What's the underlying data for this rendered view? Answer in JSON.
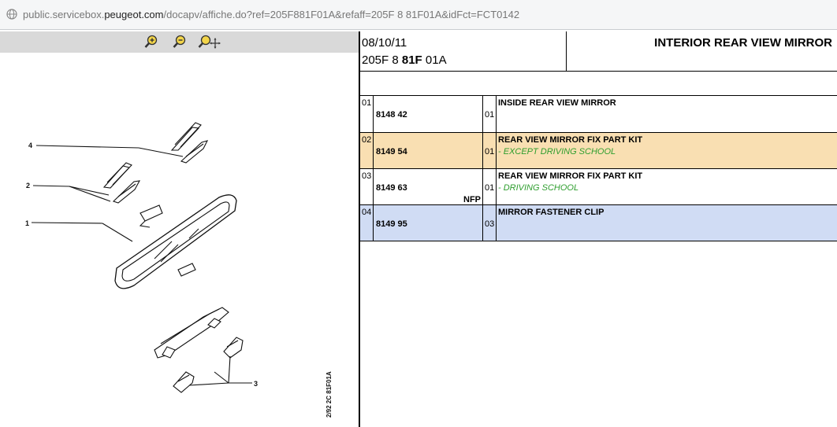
{
  "browser": {
    "url_prefix": "public.servicebox.",
    "url_domain": "peugeot.com",
    "url_suffix": "/docapv/affiche.do?ref=205F881F01A&refaff=205F 8 81F01A&idFct=FCT0142"
  },
  "toolbar": {
    "icons": [
      "zoom-in-icon",
      "zoom-out-icon",
      "zoom-pan-icon"
    ]
  },
  "diagram": {
    "callouts": [
      "4",
      "2",
      "1",
      "3"
    ],
    "stamp": "2/92 2C 81F01A"
  },
  "header": {
    "date": "08/10/11",
    "ref_prefix": "205F 8 ",
    "ref_bold": "81F",
    "ref_suffix": " 01A",
    "title": "INTERIOR REAR VIEW MIRROR"
  },
  "parts": [
    {
      "pos": "01",
      "part_no": "8148 42",
      "flag": "",
      "qty": "01",
      "desc": "INSIDE REAR VIEW MIRROR",
      "note": ""
    },
    {
      "pos": "02",
      "part_no": "8149 54",
      "flag": "",
      "qty": "01",
      "desc": "REAR VIEW MIRROR FIX PART KIT",
      "note": "- EXCEPT DRIVING SCHOOL"
    },
    {
      "pos": "03",
      "part_no": "8149 63",
      "flag": "NFP",
      "qty": "01",
      "desc": "REAR VIEW MIRROR FIX PART KIT",
      "note": "- DRIVING SCHOOL"
    },
    {
      "pos": "04",
      "part_no": "8149 95",
      "flag": "",
      "qty": "03",
      "desc": "MIRROR FASTENER CLIP",
      "note": ""
    }
  ],
  "colors": {
    "selected_row": "#f9dfb2",
    "alt_row": "#d0dcf4",
    "note_text": "#2e9e2e",
    "toolbar_bg": "#d9d9d9"
  }
}
